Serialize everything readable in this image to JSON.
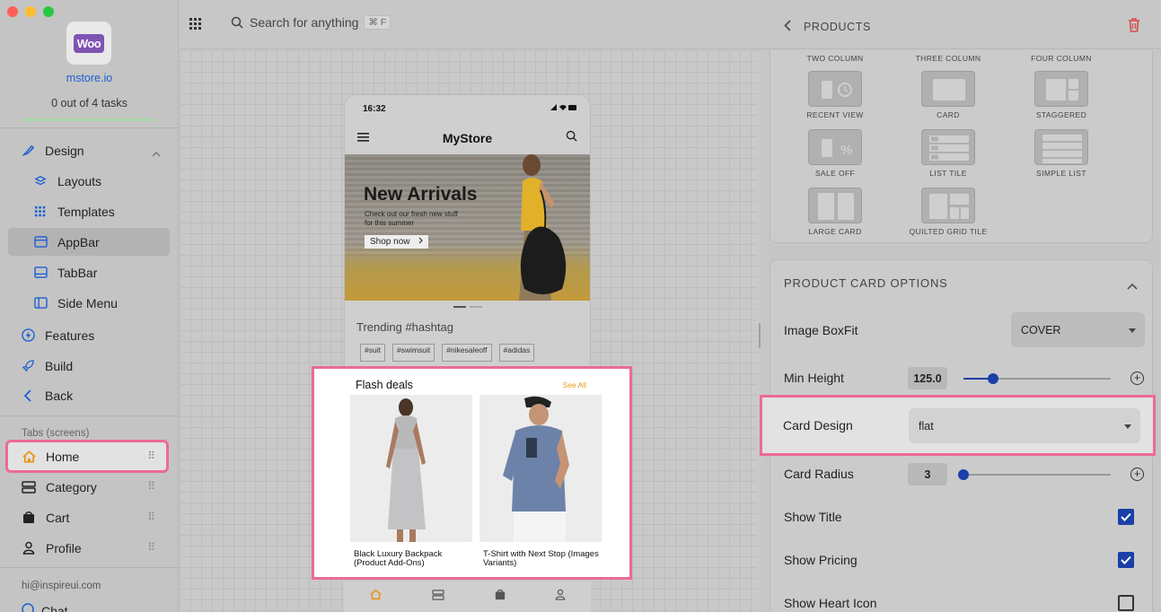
{
  "sidebar": {
    "site": "mstore.io",
    "tasks": "0 out of 4 tasks",
    "design": "Design",
    "items": [
      {
        "label": "Layouts",
        "icon": "layers-icon"
      },
      {
        "label": "Templates",
        "icon": "grid-dots-icon"
      },
      {
        "label": "AppBar",
        "icon": "appbar-icon"
      },
      {
        "label": "TabBar",
        "icon": "tabbar-icon"
      },
      {
        "label": "Side Menu",
        "icon": "side-menu-icon"
      }
    ],
    "features": "Features",
    "build": "Build",
    "back": "Back",
    "tabs_section": "Tabs (screens)",
    "tabs": [
      {
        "label": "Home",
        "icon": "home-icon"
      },
      {
        "label": "Category",
        "icon": "category-icon"
      },
      {
        "label": "Cart",
        "icon": "cart-icon"
      },
      {
        "label": "Profile",
        "icon": "profile-icon"
      }
    ],
    "email": "hi@inspireui.com",
    "chat": "Chat"
  },
  "topbar": {
    "search_placeholder": "Search for anything",
    "shortcut": "⌘ F",
    "breadcrumb": "PRODUCTS"
  },
  "preview": {
    "time": "16:32",
    "app_title": "MyStore",
    "banner_title": "New Arrivals",
    "banner_sub": "Check out our fresh new stuff for this summer",
    "banner_cta": "Shop now",
    "trending": "Trending #hashtag",
    "tags": [
      "#suit",
      "#swimsuit",
      "#nikesaleoff",
      "#adidas"
    ],
    "flash_title": "Flash deals",
    "see_all": "See All",
    "products": [
      {
        "name": "Black Luxury Backpack (Product Add-Ons)"
      },
      {
        "name": "T-Shirt with Next Stop (Images Variants)"
      }
    ]
  },
  "layouts": {
    "top_labels": [
      "TWO COLUMN",
      "THREE COLUMN",
      "FOUR COLUMN"
    ],
    "tiles": [
      "RECENT VIEW",
      "CARD",
      "STAGGERED",
      "SALE OFF",
      "LIST TILE",
      "SIMPLE LIST",
      "LARGE CARD",
      "QUILTED GRID TILE"
    ]
  },
  "options": {
    "title": "PRODUCT CARD OPTIONS",
    "image_boxfit_label": "Image BoxFit",
    "image_boxfit_value": "COVER",
    "min_height_label": "Min Height",
    "min_height_value": "125.0",
    "min_height_level": 0.2,
    "card_design_label": "Card Design",
    "card_design_value": "flat",
    "card_radius_label": "Card Radius",
    "card_radius_value": "3",
    "card_radius_level": 0.0,
    "show_title_label": "Show Title",
    "show_title": true,
    "show_pricing_label": "Show Pricing",
    "show_pricing": true,
    "show_heart_label": "Show Heart Icon",
    "show_heart": false
  },
  "colors": {
    "accent": "#1a3fa8",
    "highlight": "#ec6b95",
    "woo": "#7f54b3"
  }
}
